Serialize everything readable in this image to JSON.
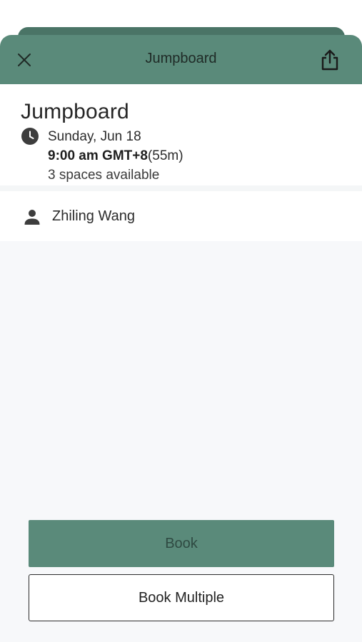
{
  "header": {
    "title": "Jumpboard",
    "close_icon": "close-icon",
    "share_icon": "share-icon"
  },
  "event": {
    "title": "Jumpboard",
    "date": "Sunday, Jun 18",
    "time": "9:00 am GMT+8",
    "duration": "(55m)",
    "spaces": "3 spaces available",
    "clock_icon": "clock-icon"
  },
  "instructor": {
    "name": "Zhiling Wang",
    "icon": "person-icon"
  },
  "actions": {
    "book_label": "Book",
    "book_multiple_label": "Book Multiple"
  },
  "colors": {
    "header": "#5a8a7a",
    "header_back": "#4a7466",
    "book_button": "#5a8a7a",
    "page_background": "#f7f8fa"
  }
}
